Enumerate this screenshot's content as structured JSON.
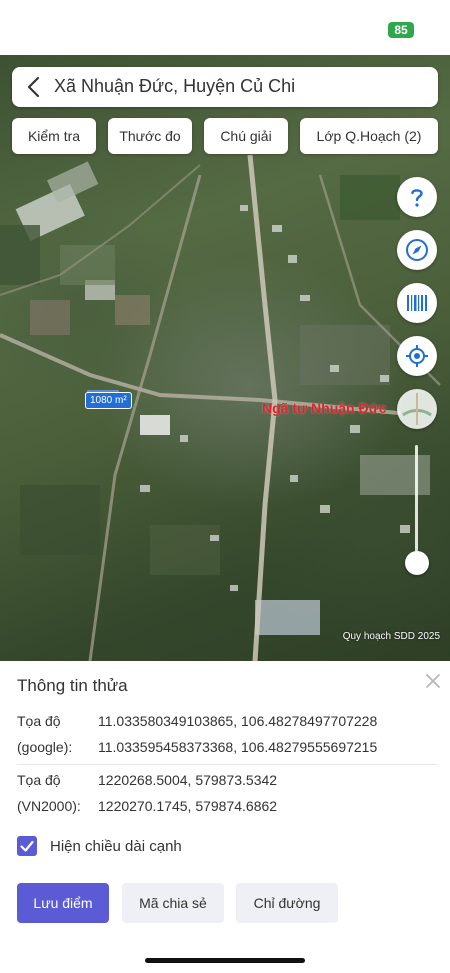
{
  "status_bar": {
    "battery": "85"
  },
  "header": {
    "title": "Xã Nhuận Đức, Huyện Củ Chi"
  },
  "toolbar": {
    "chips": [
      {
        "label": "Kiểm tra"
      },
      {
        "label": "Thước đo"
      },
      {
        "label": "Chú giải"
      },
      {
        "label": "Lớp Q.Hoạch (2)"
      }
    ]
  },
  "map": {
    "place_label": "Ngã tư Nhuận Đức",
    "parcel_area": "1080 m²",
    "watermark": "Quy hoạch SDD 2025",
    "side_buttons": [
      "help-icon",
      "compass-icon",
      "barcode-icon",
      "locate-icon"
    ]
  },
  "panel": {
    "title": "Thông tin thửa",
    "google": {
      "label_line1": "Tọa độ",
      "label_line2": "(google):",
      "value_line1": "11.033580349103865, 106.48278497707228",
      "value_line2": "11.033595458373368, 106.48279555697215"
    },
    "vn2000": {
      "label_line1": "Tọa độ",
      "label_line2": "(VN2000):",
      "value_line1": "1220268.5004, 579873.5342",
      "value_line2": "1220270.1745, 579874.6862"
    },
    "checkbox": {
      "label": "Hiện chiều dài cạnh",
      "checked": true
    },
    "buttons": {
      "save": "Lưu điểm",
      "share": "Mã chia sẻ",
      "directions": "Chỉ đường"
    }
  },
  "colors": {
    "accent": "#5b5bd6",
    "fab_icon": "#1f6fd6",
    "place_label": "#e0242b",
    "battery": "#2ea84a"
  }
}
